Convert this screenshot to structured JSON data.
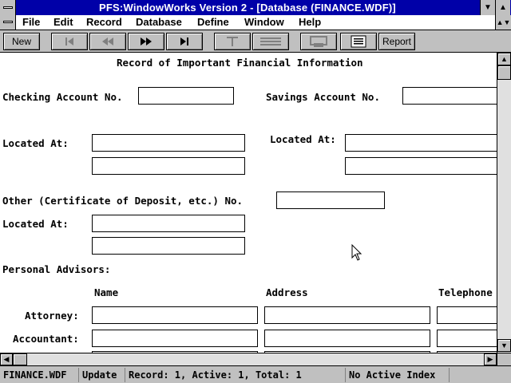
{
  "window": {
    "title": "PFS:WindowWorks Version 2 - [Database  (FINANCE.WDF)]",
    "minimize_icon": "down-arrow-icon",
    "maximize_icon": "up-arrow-icon"
  },
  "menu": {
    "items": [
      "File",
      "Edit",
      "Record",
      "Database",
      "Define",
      "Window",
      "Help"
    ],
    "restore_icon": "restore-icon"
  },
  "toolbar": {
    "new_label": "New",
    "report_label": "Report",
    "first_record_icon": "first-record-icon",
    "prev_record_icon": "previous-record-icon",
    "next_record_icon": "next-record-icon",
    "last_record_icon": "last-record-icon",
    "text_tool_icon": "text-tool-icon",
    "field_tool_icon": "field-tool-icon",
    "print_icon": "print-icon",
    "form_view_icon": "form-view-icon"
  },
  "form": {
    "title": "Record of Important Financial Information",
    "checking_label": "Checking Account No.",
    "savings_label": "Savings Account No.",
    "located_at_label": "Located At:",
    "other_label": "Other (Certificate of Deposit, etc.) No.",
    "advisors_label": "Personal Advisors:",
    "col_name": "Name",
    "col_address": "Address",
    "col_telephone": "Telephone",
    "attorney_label": "Attorney:",
    "accountant_label": "Accountant:",
    "fields": {
      "checking_account": "",
      "savings_account": "",
      "checking_located_1": "",
      "checking_located_2": "",
      "savings_located_1": "",
      "savings_located_2": "",
      "other_no": "",
      "other_located_1": "",
      "other_located_2": "",
      "attorney_name": "",
      "attorney_address": "",
      "attorney_phone": "",
      "accountant_name": "",
      "accountant_address": "",
      "accountant_phone": ""
    }
  },
  "status": {
    "file": "FINANCE.WDF",
    "mode": "Update",
    "record_info": "Record:   1, Active:   1, Total:   1",
    "index": "No Active Index"
  }
}
